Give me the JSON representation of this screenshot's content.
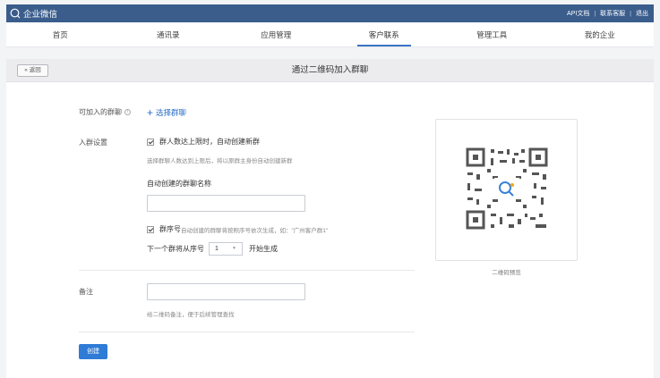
{
  "topbar": {
    "logo_text": "企业微信",
    "links": [
      "API文档",
      "联系客服",
      "退出"
    ]
  },
  "nav": {
    "items": [
      {
        "label": "首页"
      },
      {
        "label": "通讯录"
      },
      {
        "label": "应用管理"
      },
      {
        "label": "客户联系",
        "active": true
      },
      {
        "label": "管理工具"
      },
      {
        "label": "我的企业"
      }
    ]
  },
  "titlebar": {
    "back_label": "« 返回",
    "title": "通过二维码加入群聊"
  },
  "form": {
    "group_label": "可加入的群聊",
    "select_group_label": "选择群聊",
    "settings_label": "入群设置",
    "auto_create_label": "群人数达上限时，自动创建新群",
    "auto_create_hint": "选择群聊人数达到上限后，将以原群主身份自动创建新群",
    "group_name_label": "自动创建的群聊名称",
    "group_name_value": "",
    "serial_label": "群序号",
    "serial_hint": "自动创建的群聊将按照序号依次生成，如：\"广州客户群1\"",
    "next_prefix": "下一个群将从序号",
    "next_value": "1",
    "next_suffix": "开始生成",
    "remark_label": "备注",
    "remark_value": "",
    "remark_hint": "给二维码备注，便于后续管理查找",
    "create_label": "创建"
  },
  "qr": {
    "caption": "二维码预览"
  },
  "colors": {
    "topbar": "#3a5d8c",
    "accent": "#2f7bd6",
    "link": "#2b6fc4"
  }
}
